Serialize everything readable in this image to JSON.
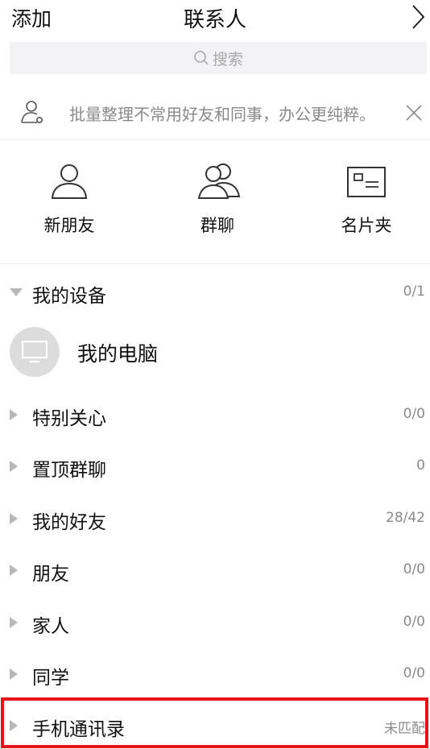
{
  "header": {
    "left_action": "添加",
    "title": "联系人",
    "right_icon": "chevron-right-icon"
  },
  "search": {
    "placeholder": "搜索"
  },
  "notice": {
    "text": "批量整理不常用好友和同事，办公更纯粹。"
  },
  "shortcuts": [
    {
      "label": "新朋友",
      "icon": "person-icon"
    },
    {
      "label": "群聊",
      "icon": "group-icon"
    },
    {
      "label": "名片夹",
      "icon": "card-icon"
    }
  ],
  "groups": [
    {
      "name": "我的设备",
      "count": "0/1",
      "expanded": true
    },
    {
      "name": "特别关心",
      "count": "0/0"
    },
    {
      "name": "置顶群聊",
      "count": "0"
    },
    {
      "name": "我的好友",
      "count": "28/42"
    },
    {
      "name": "朋友",
      "count": "0/0"
    },
    {
      "name": "家人",
      "count": "0/0"
    },
    {
      "name": "同学",
      "count": "0/0"
    },
    {
      "name": "手机通讯录",
      "count": "未匹配",
      "highlighted": true
    }
  ],
  "device": {
    "name": "我的电脑",
    "icon": "monitor-icon"
  },
  "colors": {
    "highlight": "#e8141b",
    "muted_text": "#8a8a8a",
    "search_bg": "#f3f3f5"
  }
}
